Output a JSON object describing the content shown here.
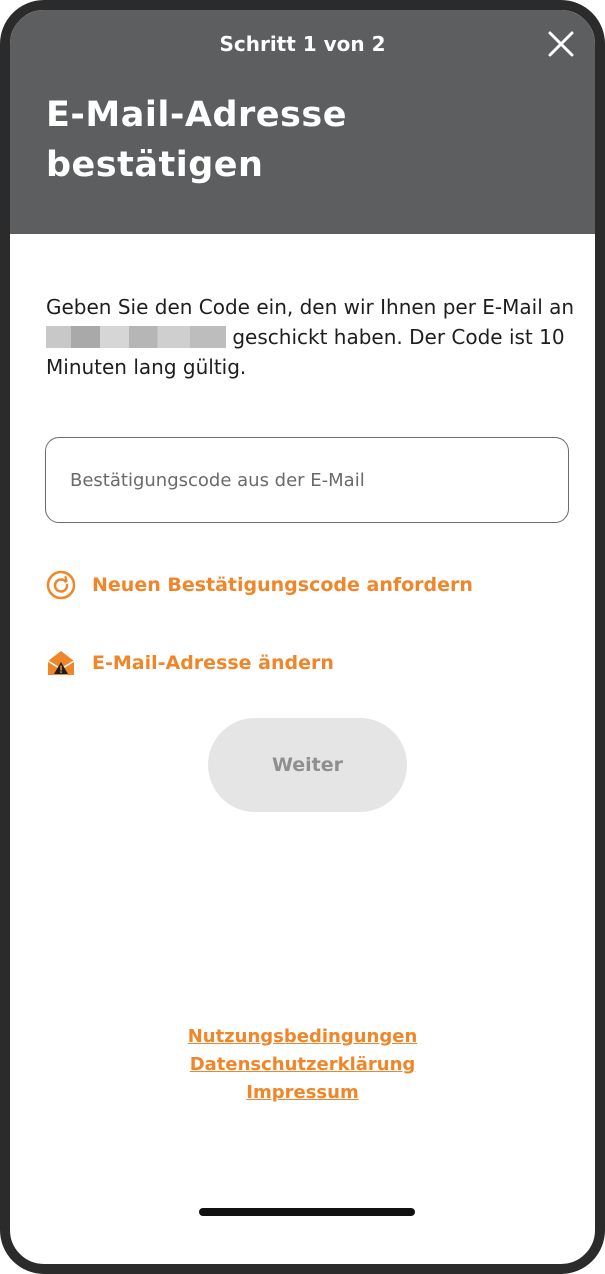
{
  "header": {
    "step": "Schritt 1 von 2",
    "title": "E-Mail-Adresse bestätigen"
  },
  "instructions": {
    "before": "Geben Sie den Code ein, den wir Ihnen per E-Mail an",
    "after": "geschickt haben. Der Code ist 10 Minuten lang gültig."
  },
  "code_input": {
    "placeholder": "Bestätigungscode aus der E-Mail",
    "value": ""
  },
  "actions": {
    "resend_label": "Neuen Bestätigungscode anfordern",
    "change_email_label": "E-Mail-Adresse ändern",
    "continue_label": "Weiter"
  },
  "footer": {
    "terms": "Nutzungsbedingungen",
    "privacy": "Datenschutzerklärung",
    "imprint": "Impressum"
  },
  "colors": {
    "header_bg": "#5c5e5f",
    "accent": "#f0862a",
    "button_disabled_bg": "#e5e5e5",
    "button_disabled_text": "#8f8f8f"
  },
  "icons": {
    "close": "close-icon",
    "resend": "refresh-icon",
    "change_email": "envelope-alert-icon"
  }
}
